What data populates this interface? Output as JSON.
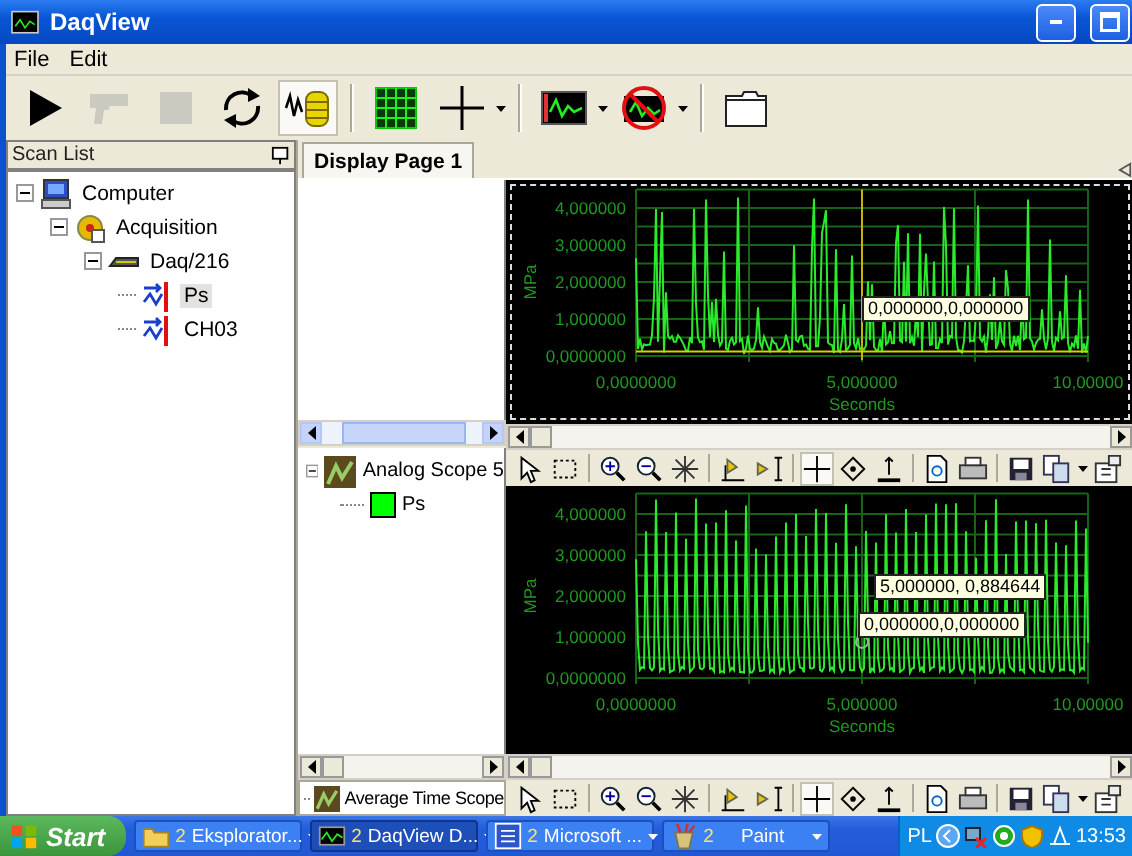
{
  "window": {
    "title": "DaqView"
  },
  "menu": [
    "File",
    "Edit"
  ],
  "toolbar": [
    {
      "buttons": [
        {
          "kind": "play",
          "disabled": false,
          "pressed": false,
          "dropdown": false
        },
        {
          "kind": "pistol",
          "disabled": true,
          "pressed": false,
          "dropdown": false
        },
        {
          "kind": "stop",
          "disabled": true,
          "pressed": false,
          "dropdown": false
        },
        {
          "kind": "cycle",
          "disabled": false,
          "pressed": false,
          "dropdown": false
        },
        {
          "kind": "wave-database",
          "disabled": false,
          "pressed": true,
          "dropdown": false
        }
      ]
    },
    {
      "buttons": [
        {
          "kind": "grid",
          "disabled": false,
          "pressed": false,
          "dropdown": false
        },
        {
          "kind": "crosshair",
          "disabled": false,
          "pressed": false,
          "dropdown": true
        }
      ]
    },
    {
      "buttons": [
        {
          "kind": "scope",
          "disabled": false,
          "pressed": false,
          "dropdown": true
        },
        {
          "kind": "scope-off",
          "disabled": false,
          "pressed": false,
          "dropdown": true
        }
      ]
    },
    {
      "buttons": [
        {
          "kind": "window",
          "disabled": false,
          "pressed": false,
          "dropdown": false
        }
      ]
    }
  ],
  "scan_list": {
    "title": "Scan List",
    "tree": [
      {
        "label": "Computer",
        "kind": "computer",
        "expanded": true,
        "selected": false,
        "children": [
          {
            "label": "Acquisition",
            "kind": "acquisition",
            "expanded": true,
            "selected": false,
            "children": [
              {
                "label": "Daq/216",
                "kind": "device",
                "expanded": true,
                "selected": false,
                "children": [
                  {
                    "label": "Ps",
                    "kind": "channel",
                    "selected": true
                  },
                  {
                    "label": "CH03",
                    "kind": "channel",
                    "selected": false
                  }
                ]
              }
            ]
          }
        ]
      }
    ]
  },
  "display_tabs": [
    {
      "label": "Display Page 1",
      "selected": true
    }
  ],
  "scope_tree": [
    {
      "label": "Analog Scope 5",
      "expanded": true,
      "children": [
        {
          "label": "Ps",
          "color": "#00ff00"
        }
      ]
    }
  ],
  "second_scope": {
    "label": "Average Time Scope"
  },
  "charts": [
    {
      "focused": true,
      "cursor": true,
      "marker": false,
      "ylabel": "MPa",
      "xlabel": "Seconds",
      "yticks": [
        "4,000000",
        "3,000000",
        "2,000000",
        "1,000000",
        "0,0000000"
      ],
      "xticks": [
        "0,0000000",
        "5,000000",
        "10,00000"
      ],
      "readouts": [
        "0,000000,0,000000"
      ]
    },
    {
      "focused": false,
      "cursor": false,
      "marker": true,
      "ylabel": "MPa",
      "xlabel": "Seconds",
      "yticks": [
        "4,000000",
        "3,000000",
        "2,000000",
        "1,000000",
        "0,0000000"
      ],
      "xticks": [
        "0,0000000",
        "5,000000",
        "10,00000"
      ],
      "readouts": [
        "5,000000, 0,884644",
        "0,000000,0,000000"
      ]
    }
  ],
  "scope_toolbars": [
    {
      "groups": [
        [
          {
            "kind": "pointer",
            "pressed": false,
            "dropdown": false
          },
          {
            "kind": "marquee",
            "pressed": false,
            "dropdown": false
          }
        ],
        [
          {
            "kind": "zoom-in",
            "pressed": false,
            "dropdown": false
          },
          {
            "kind": "zoom-out",
            "pressed": false,
            "dropdown": false
          },
          {
            "kind": "burst",
            "pressed": false,
            "dropdown": false
          }
        ],
        [
          {
            "kind": "axis-x",
            "pressed": false,
            "dropdown": false
          },
          {
            "kind": "axis-y",
            "pressed": false,
            "dropdown": false
          }
        ],
        [
          {
            "kind": "crosshair",
            "pressed": true,
            "dropdown": false
          },
          {
            "kind": "cursor",
            "pressed": false,
            "dropdown": false
          },
          {
            "kind": "level",
            "pressed": false,
            "dropdown": false
          }
        ],
        [
          {
            "kind": "preview",
            "pressed": false,
            "dropdown": false
          },
          {
            "kind": "print",
            "pressed": false,
            "dropdown": false
          }
        ],
        [
          {
            "kind": "save",
            "pressed": false,
            "dropdown": false
          },
          {
            "kind": "copy",
            "pressed": false,
            "dropdown": true
          },
          {
            "kind": "properties",
            "pressed": false,
            "dropdown": false
          }
        ]
      ]
    },
    {
      "groups": [
        [
          {
            "kind": "pointer",
            "pressed": false,
            "dropdown": false
          },
          {
            "kind": "marquee",
            "pressed": false,
            "dropdown": false
          }
        ],
        [
          {
            "kind": "zoom-in",
            "pressed": false,
            "dropdown": false
          },
          {
            "kind": "zoom-out",
            "pressed": false,
            "dropdown": false
          },
          {
            "kind": "burst",
            "pressed": false,
            "dropdown": false
          }
        ],
        [
          {
            "kind": "axis-x",
            "pressed": false,
            "dropdown": false
          },
          {
            "kind": "axis-y",
            "pressed": false,
            "dropdown": false
          }
        ],
        [
          {
            "kind": "crosshair",
            "pressed": true,
            "dropdown": false
          },
          {
            "kind": "cursor",
            "pressed": false,
            "dropdown": false
          },
          {
            "kind": "level",
            "pressed": false,
            "dropdown": false
          }
        ],
        [
          {
            "kind": "preview",
            "pressed": false,
            "dropdown": false
          },
          {
            "kind": "print",
            "pressed": false,
            "dropdown": false
          }
        ],
        [
          {
            "kind": "save",
            "pressed": false,
            "dropdown": false
          },
          {
            "kind": "copy",
            "pressed": false,
            "dropdown": true
          },
          {
            "kind": "properties",
            "pressed": false,
            "dropdown": false
          }
        ]
      ]
    }
  ],
  "taskbar": {
    "start": "Start",
    "tasks": [
      {
        "kind": "folder",
        "count": "2",
        "label": "Eksplorator...",
        "selected": false
      },
      {
        "kind": "scope",
        "count": "2",
        "label": "DaqView D...",
        "selected": true
      },
      {
        "kind": "document",
        "count": "2",
        "label": "Microsoft ...",
        "selected": false
      },
      {
        "kind": "paint",
        "count": "2",
        "label": "Paint",
        "selected": false
      }
    ],
    "language": "PL",
    "clock": "13:53"
  }
}
